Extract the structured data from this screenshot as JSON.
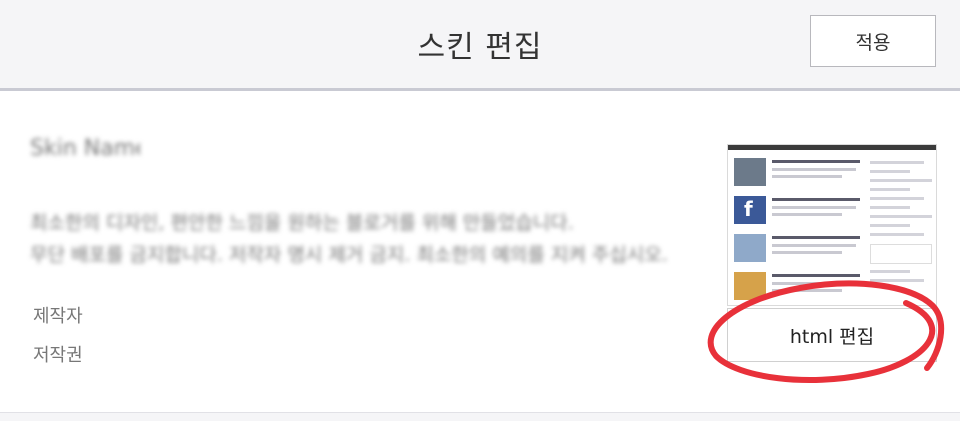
{
  "header": {
    "title": "스킨 편집",
    "apply_label": "적용"
  },
  "skin": {
    "name": "Skin Name",
    "description_1": "최소한의 디자인, 편안한 느낌을 원하는 블로거를 위해 만들었습니다.",
    "description_2": "무단 배포를 금지합니다. 저작자 명시 제거 금지. 최소한의 예의를 지켜 주십시오.",
    "author_label": "제작자",
    "copyright_label": "저작권"
  },
  "preview": {
    "html_edit_label": "html 편집"
  },
  "colors": {
    "annotation": "#e8313a",
    "header_bg": "#f5f5f7"
  }
}
